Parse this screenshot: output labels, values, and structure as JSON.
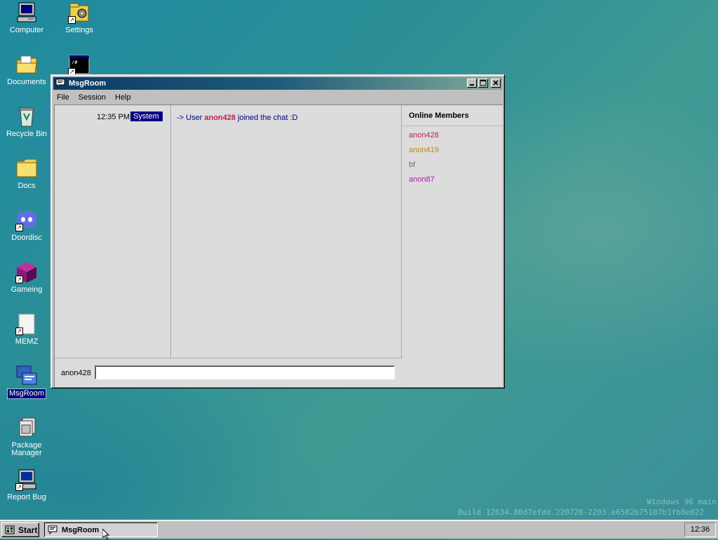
{
  "desktop": {
    "icons": [
      {
        "label": "Computer",
        "icon": "computer-icon"
      },
      {
        "label": "Settings",
        "icon": "settings-icon"
      },
      {
        "label": "Documents",
        "icon": "documents-folder-icon"
      },
      {
        "label": "Terminal",
        "icon": "terminal-icon"
      },
      {
        "label": "Recycle Bin",
        "icon": "recycle-bin-icon"
      },
      {
        "label": "Docs",
        "icon": "docs-folder-icon"
      },
      {
        "label": "Doordisc",
        "icon": "doordisc-icon"
      },
      {
        "label": "Gameing",
        "icon": "gameing-icon"
      },
      {
        "label": "MEMZ",
        "icon": "memz-icon"
      },
      {
        "label": "MsgRoom",
        "icon": "msgroom-icon"
      },
      {
        "label": "Package Manager",
        "icon": "package-manager-icon"
      },
      {
        "label": "Report Bug",
        "icon": "report-bug-icon"
      }
    ],
    "watermark_line1": "Windows 96 main",
    "watermark_line2": "Build 12634.80d7efdd.220728-2203.e6582b75107b1fb8e022"
  },
  "window": {
    "title": "MsgRoom",
    "menu": [
      "File",
      "Session",
      "Help"
    ],
    "messages": [
      {
        "time": "12:35 PM",
        "sender": "System",
        "prefix": "-> User",
        "user": "anon428",
        "suffix": "joined the chat :D"
      }
    ],
    "members_header": "Online Members",
    "members": [
      {
        "name": "anon428",
        "color": "#c0214a"
      },
      {
        "name": "anon419",
        "color": "#b58a12"
      },
      {
        "name": "bf",
        "color": "#7a6a52"
      },
      {
        "name": "anon87",
        "color": "#a020b0"
      }
    ],
    "nickname": "anon428",
    "input_value": ""
  },
  "taskbar": {
    "start_label": "Start",
    "task_label": "MsgRoom",
    "clock": "12:36"
  }
}
